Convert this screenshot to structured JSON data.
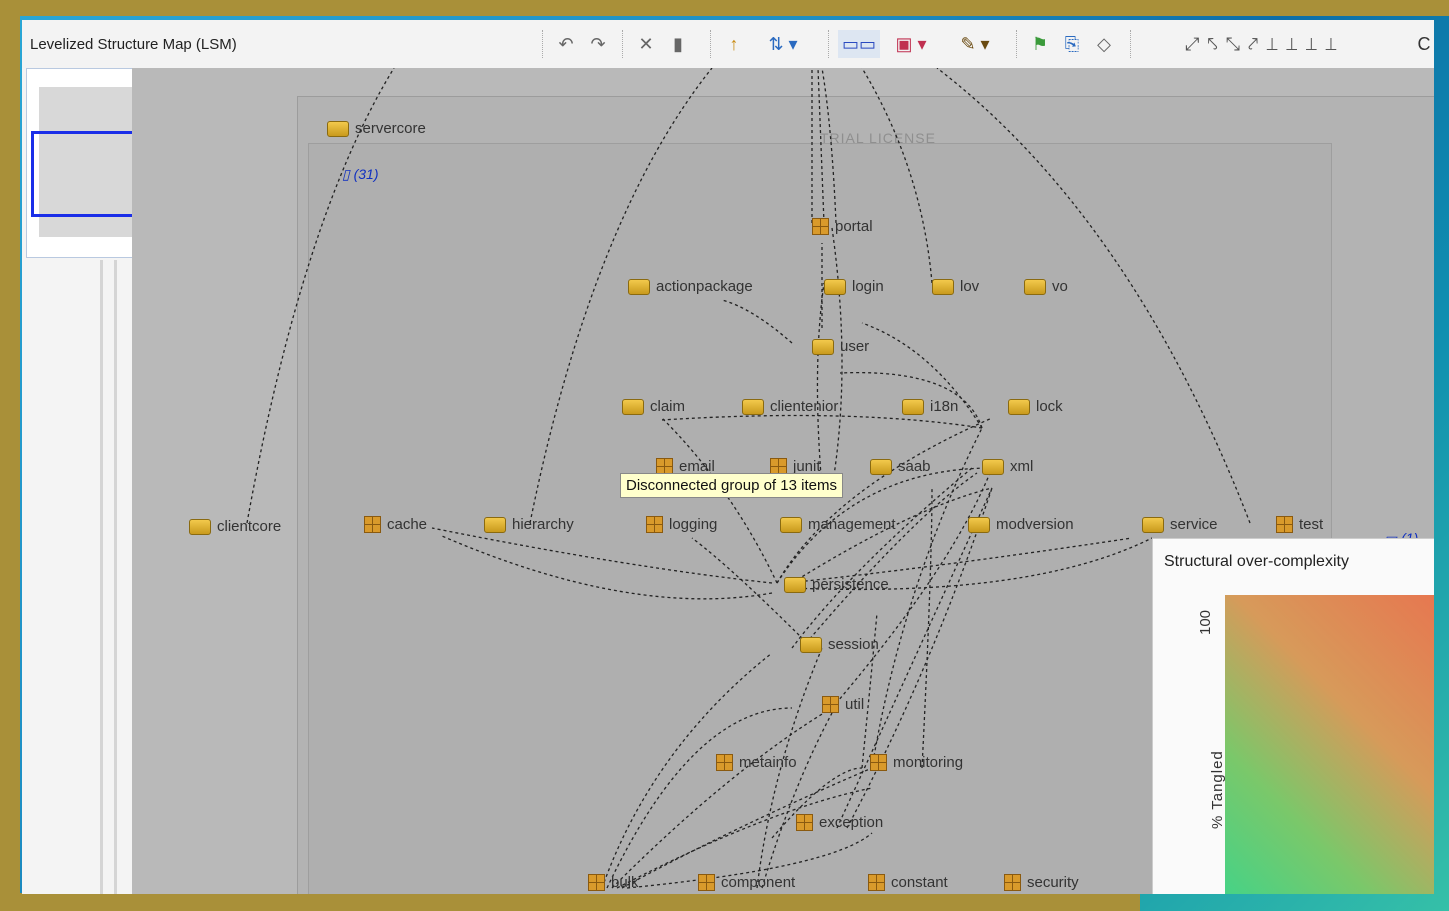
{
  "window": {
    "title": "Levelized Structure Map (LSM)"
  },
  "toolbar": {
    "icons": [
      "undo-icon",
      "redo-icon",
      "cut-icon",
      "paste-icon",
      "level-up-icon",
      "level-menu-icon",
      "grid-icon",
      "box-menu-icon",
      "brush-menu-icon",
      "person-icon",
      "export-icon",
      "diamond-icon",
      "arrow-tools-icon"
    ],
    "overflow_label": "C"
  },
  "canvas": {
    "watermark": "TRIAL LICENSE",
    "root": "servercore",
    "inner_count": "(31)",
    "side_count": "(1)",
    "outside_node": "clientcore",
    "tooltip": "Disconnected group of 13 items",
    "nodes": {
      "portal": "portal",
      "actionpackage": "actionpackage",
      "login": "login",
      "lov": "lov",
      "vo": "vo",
      "user": "user",
      "claim": "claim",
      "clientenior": "clientenior",
      "i18n": "i18n",
      "lock": "lock",
      "email": "email",
      "junit": "junit",
      "saab": "saab",
      "xml": "xml",
      "cache": "cache",
      "hierarchy": "hierarchy",
      "logging": "logging",
      "management": "management",
      "modversion": "modversion",
      "service": "service",
      "test": "test",
      "persistence": "persistence",
      "session": "session",
      "util": "util",
      "metainfo": "metainfo",
      "monitoring": "monitoring",
      "exception": "exception",
      "bulk": "bulk",
      "component": "component",
      "constant": "constant",
      "security": "security"
    }
  },
  "chart": {
    "title": "Structural over-complexity",
    "y_label": "% Tangled",
    "y_max": "100",
    "colors": {
      "low": "#3fd48a",
      "high": "#e8744f"
    }
  }
}
